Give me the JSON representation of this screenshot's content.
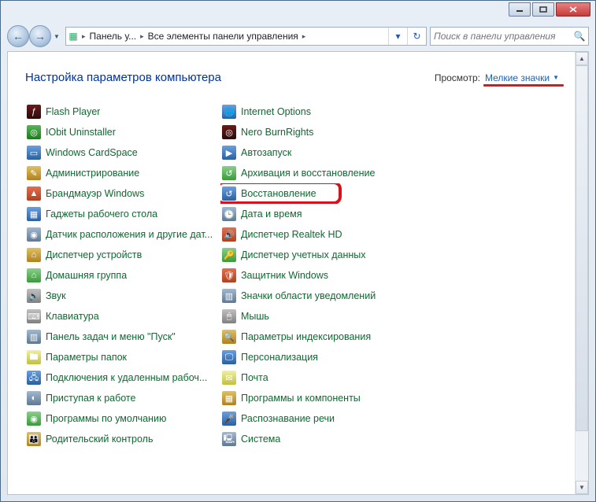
{
  "window": {
    "minimize_title": "Свернуть",
    "maximize_title": "Развернуть",
    "close_title": "Закрыть"
  },
  "breadcrumb": {
    "seg1": "Панель у...",
    "seg2": "Все элементы панели управления"
  },
  "search": {
    "placeholder": "Поиск в панели управления"
  },
  "header": {
    "title": "Настройка параметров компьютера",
    "view_label": "Просмотр:",
    "view_value": "Мелкие значки"
  },
  "column1": [
    {
      "label": "Flash Player",
      "ic": "c0",
      "g": "ƒ"
    },
    {
      "label": "IObit Uninstaller",
      "ic": "c1",
      "g": "◎"
    },
    {
      "label": "Windows CardSpace",
      "ic": "c2",
      "g": "▭"
    },
    {
      "label": "Администрирование",
      "ic": "c3",
      "g": "✎"
    },
    {
      "label": "Брандмауэр Windows",
      "ic": "c4",
      "g": "▲"
    },
    {
      "label": "Гаджеты рабочего стола",
      "ic": "c2",
      "g": "▦"
    },
    {
      "label": "Датчик расположения и другие дат...",
      "ic": "c5",
      "g": "◉"
    },
    {
      "label": "Диспетчер устройств",
      "ic": "c3",
      "g": "⌂"
    },
    {
      "label": "Домашняя группа",
      "ic": "c7",
      "g": "⌂"
    },
    {
      "label": "Звук",
      "ic": "c6",
      "g": "🔊"
    },
    {
      "label": "Клавиатура",
      "ic": "c6",
      "g": "⌨"
    },
    {
      "label": "Панель задач и меню \"Пуск\"",
      "ic": "c5",
      "g": "▥"
    },
    {
      "label": "Параметры папок",
      "ic": "c9",
      "g": "🖿"
    },
    {
      "label": "Подключения к удаленным рабоч...",
      "ic": "c2",
      "g": "🖧"
    },
    {
      "label": "Приступая к работе",
      "ic": "c5",
      "g": "◐"
    },
    {
      "label": "Программы по умолчанию",
      "ic": "c7",
      "g": "◉"
    },
    {
      "label": "Родительский контроль",
      "ic": "c3",
      "g": "👪"
    }
  ],
  "column2": [
    {
      "label": "Internet Options",
      "ic": "c2",
      "g": "🌐"
    },
    {
      "label": "Nero BurnRights",
      "ic": "c0",
      "g": "◎"
    },
    {
      "label": "Автозапуск",
      "ic": "c2",
      "g": "▶"
    },
    {
      "label": "Архивация и восстановление",
      "ic": "c7",
      "g": "↺"
    },
    {
      "label": "Восстановление",
      "ic": "c2",
      "g": "↺",
      "highlighted": true
    },
    {
      "label": "Дата и время",
      "ic": "c5",
      "g": "🕒"
    },
    {
      "label": "Диспетчер Realtek HD",
      "ic": "c4",
      "g": "🔊"
    },
    {
      "label": "Диспетчер учетных данных",
      "ic": "c7",
      "g": "🔑"
    },
    {
      "label": "Защитник Windows",
      "ic": "c4",
      "g": "🛡"
    },
    {
      "label": "Значки области уведомлений",
      "ic": "c5",
      "g": "▥"
    },
    {
      "label": "Мышь",
      "ic": "c6",
      "g": "🖱"
    },
    {
      "label": "Параметры индексирования",
      "ic": "c3",
      "g": "🔍"
    },
    {
      "label": "Персонализация",
      "ic": "c2",
      "g": "🖵"
    },
    {
      "label": "Почта",
      "ic": "c9",
      "g": "✉"
    },
    {
      "label": "Программы и компоненты",
      "ic": "c3",
      "g": "▦"
    },
    {
      "label": "Распознавание речи",
      "ic": "c2",
      "g": "🎤"
    },
    {
      "label": "Система",
      "ic": "c5",
      "g": "🖳"
    }
  ]
}
